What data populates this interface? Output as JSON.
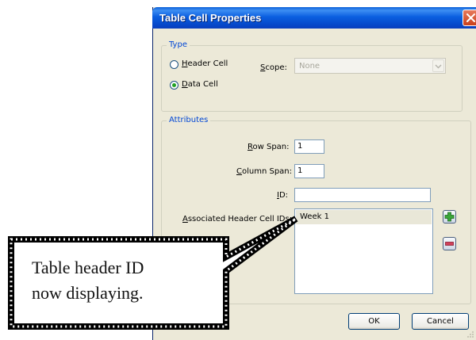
{
  "dialog": {
    "title": "Table Cell Properties"
  },
  "type_group": {
    "legend": "Type",
    "header_cell": {
      "mnemonic": "H",
      "rest": "eader Cell",
      "selected": false
    },
    "data_cell": {
      "mnemonic": "D",
      "rest": "ata Cell",
      "selected": true
    },
    "scope": {
      "mnemonic": "S",
      "rest": "cope:",
      "value": "None"
    }
  },
  "attributes_group": {
    "legend": "Attributes",
    "row_span": {
      "mnemonic": "R",
      "rest": "ow Span:",
      "value": "1"
    },
    "column_span": {
      "mnemonic": "C",
      "rest": "olumn Span:",
      "value": "1"
    },
    "id": {
      "mnemonic": "I",
      "rest": "D:",
      "value": ""
    },
    "associated": {
      "mnemonic": "A",
      "rest": "ssociated Header Cell IDs:",
      "items": [
        "Week 1"
      ]
    },
    "add_icon": "plus-icon",
    "remove_icon": "minus-icon"
  },
  "buttons": {
    "ok": "OK",
    "cancel": "Cancel"
  },
  "callout": {
    "line1": "Table header ID",
    "line2": "now displaying."
  },
  "colors": {
    "titlebar": "#0b5fe0",
    "dialog_bg": "#ece9d8",
    "legend_text": "#0046d5",
    "radio_dot": "#21a121",
    "add_icon": "#3aa63a",
    "remove_icon": "#d0415a"
  }
}
